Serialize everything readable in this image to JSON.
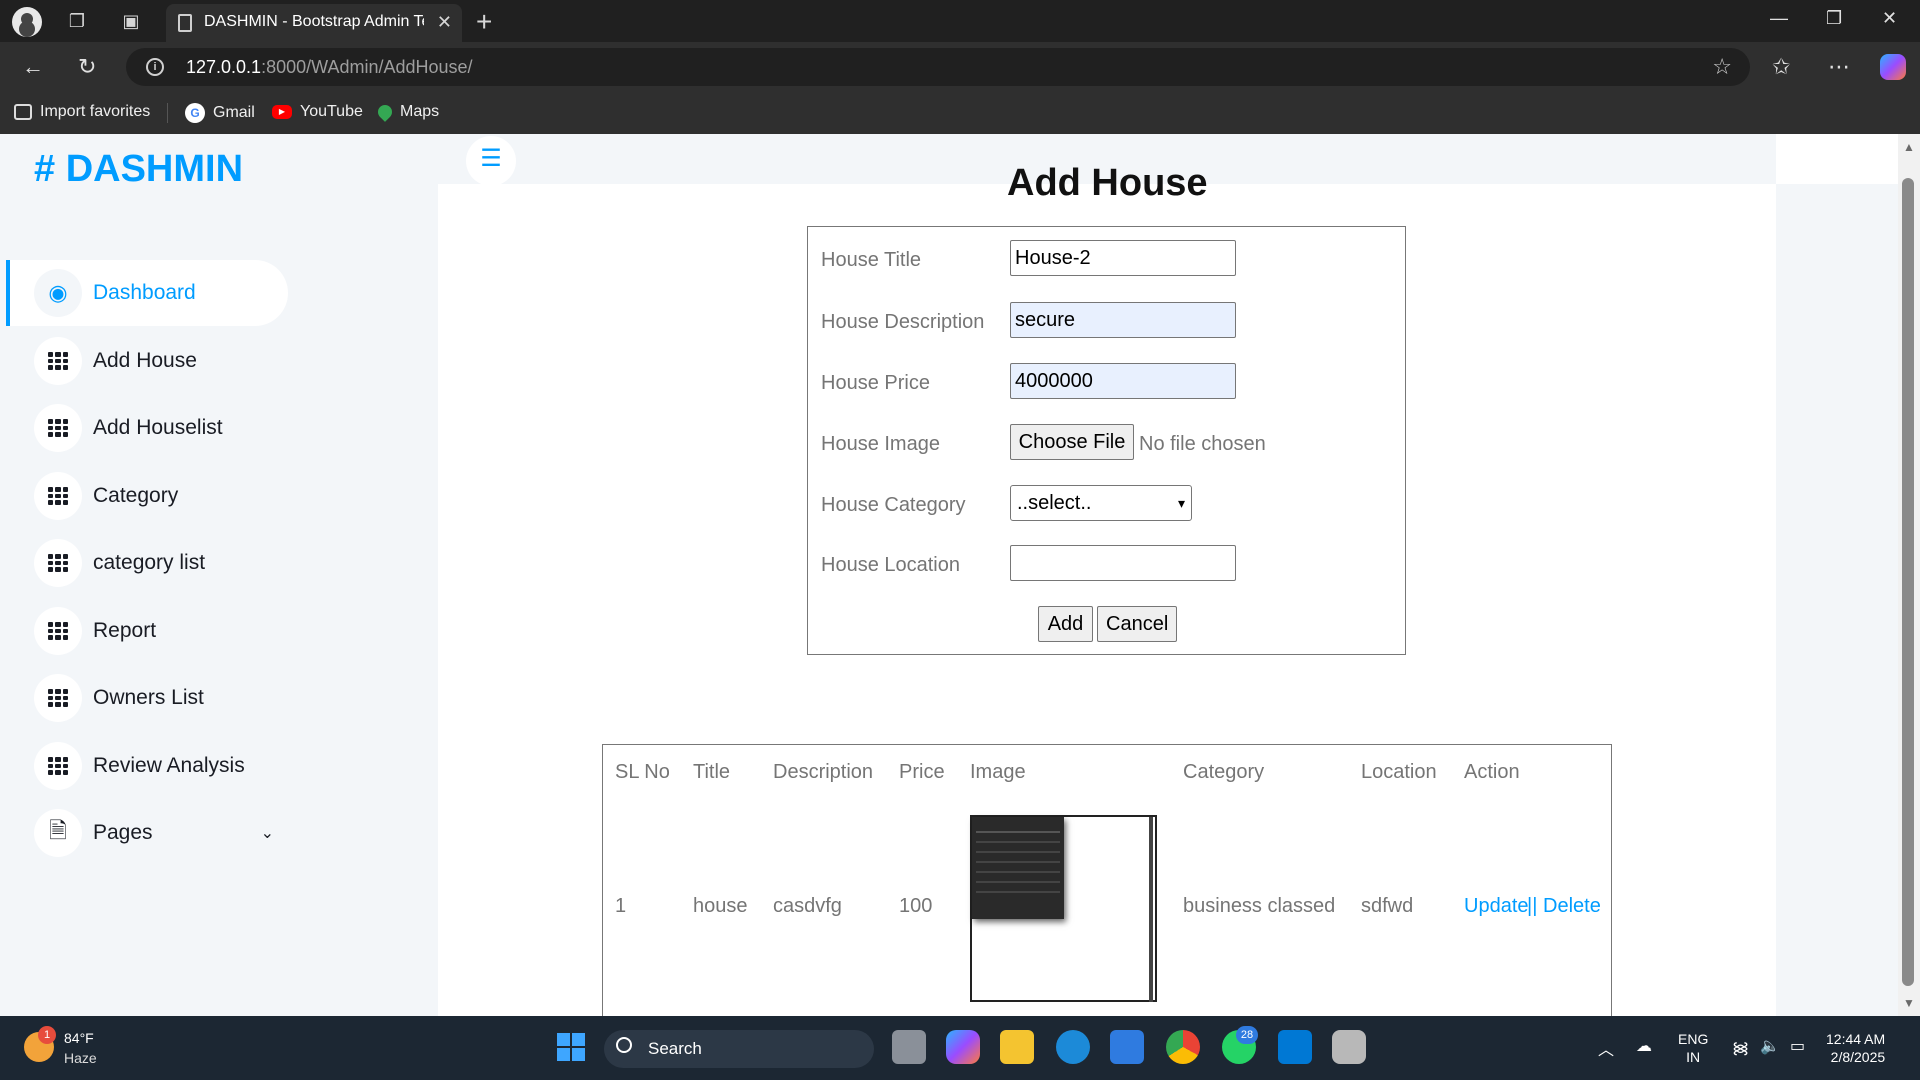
{
  "browser": {
    "tab_title": "DASHMIN - Bootstrap Admin Template",
    "url_host": "127.0.0.1",
    "url_path": ":8000/WAdmin/AddHouse/",
    "bookmarks": [
      {
        "label": "Import favorites",
        "icon": "import-icon"
      },
      {
        "label": "Gmail",
        "icon": "google-icon"
      },
      {
        "label": "YouTube",
        "icon": "youtube-icon"
      },
      {
        "label": "Maps",
        "icon": "maps-pin-icon"
      }
    ]
  },
  "sidebar": {
    "brand": "# DASHMIN",
    "items": [
      {
        "label": "Dashboard",
        "icon": "tachometer-icon",
        "active": true
      },
      {
        "label": "Add House",
        "icon": "grid-icon"
      },
      {
        "label": "Add Houselist",
        "icon": "grid-icon"
      },
      {
        "label": "Category",
        "icon": "grid-icon"
      },
      {
        "label": "category list",
        "icon": "grid-icon"
      },
      {
        "label": "Report",
        "icon": "grid-icon"
      },
      {
        "label": "Owners List",
        "icon": "grid-icon"
      },
      {
        "label": "Review Analysis",
        "icon": "grid-icon"
      },
      {
        "label": "Pages",
        "icon": "document-icon"
      }
    ]
  },
  "page": {
    "title": "Add House",
    "form": {
      "title_label": "House Title",
      "title_value": "House-2",
      "description_label": "House Description",
      "description_value": "secure",
      "price_label": "House Price",
      "price_value": "4000000",
      "image_label": "House Image",
      "file_button": "Choose File",
      "file_status": "No file chosen",
      "category_label": "House Category",
      "category_selected": "..select..",
      "location_label": "House Location",
      "location_value": "",
      "add_button": "Add",
      "cancel_button": "Cancel"
    },
    "table": {
      "headers": [
        "SL No",
        "Title",
        "Description",
        "Price",
        "Image",
        "Category",
        "Location",
        "Action"
      ],
      "rows": [
        {
          "sl": "1",
          "title": "house",
          "description": "casdvfg",
          "price": "100",
          "category": "business classed",
          "location": "sdfwd",
          "update": "Update",
          "separator": "||",
          "delete": "Delete"
        }
      ]
    }
  },
  "taskbar": {
    "weather_temp": "84°F",
    "weather_desc": "Haze",
    "weather_badge": "1",
    "search_label": "Search",
    "whatsapp_badge": "28",
    "lang_top": "ENG",
    "lang_bottom": "IN",
    "time": "12:44 AM",
    "date": "2/8/2025"
  },
  "colors": {
    "accent": "#009cff",
    "sidebar_bg": "#f3f6f9",
    "text_dark": "#191c24",
    "text_muted": "#757575"
  }
}
